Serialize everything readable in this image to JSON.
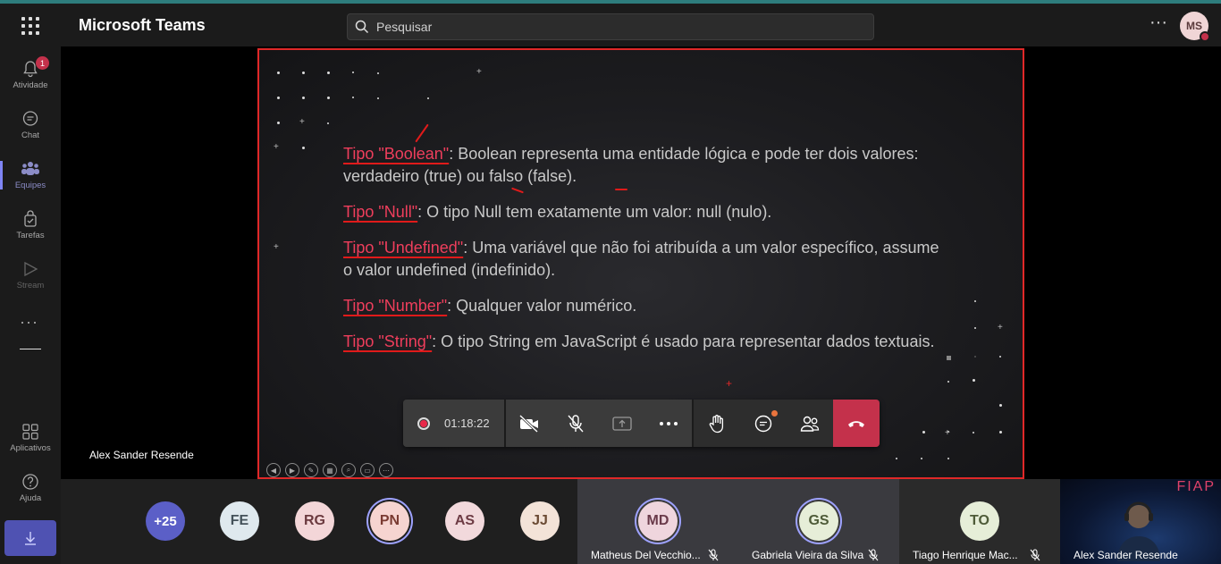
{
  "app": {
    "title": "Microsoft Teams",
    "search_placeholder": "Pesquisar",
    "accent_color": "#2e7d7d",
    "user_initials": "MS"
  },
  "rail": {
    "items": [
      {
        "label": "Atividade",
        "icon": "bell-icon",
        "badge": "1"
      },
      {
        "label": "Chat",
        "icon": "chat-icon"
      },
      {
        "label": "Equipes",
        "icon": "teams-icon",
        "active": true
      },
      {
        "label": "Tarefas",
        "icon": "tasks-icon"
      },
      {
        "label": "Stream",
        "icon": "stream-icon"
      }
    ],
    "more": "···",
    "apps_label": "Aplicativos",
    "help_label": "Ajuda"
  },
  "stage": {
    "presenter_name": "Alex Sander Resende"
  },
  "slide": {
    "items": [
      {
        "keyword": "Tipo \"Boolean\"",
        "text": ": Boolean representa uma entidade lógica e pode ter dois valores: verdadeiro (true) ou falso (false)."
      },
      {
        "keyword": "Tipo \"Null\"",
        "text": ": O tipo Null tem exatamente um valor: null (nulo)."
      },
      {
        "keyword": "Tipo \"Undefined\"",
        "text": ": Uma variável que não foi atribuída a um valor específico, assume o valor undefined (indefinido)."
      },
      {
        "keyword": "Tipo \"Number\"",
        "text": ": Qualquer valor numérico."
      },
      {
        "keyword": "Tipo \"String\"",
        "text": ": O tipo String em JavaScript é usado para representar dados textuais."
      }
    ],
    "keyword_color": "#ef3e5c",
    "annotation_color": "#e01a1a"
  },
  "callbar": {
    "timer": "01:18:22",
    "hangup_color": "#c4314b"
  },
  "participants": {
    "overflow": "+25",
    "avatars": [
      {
        "initials": "FE",
        "bg": "#dfe9ee",
        "fg": "#44525a"
      },
      {
        "initials": "RG",
        "bg": "#f3d6d8",
        "fg": "#6b3a3f"
      },
      {
        "initials": "PN",
        "bg": "#f6d4d0",
        "fg": "#7a3b32",
        "ring": true
      },
      {
        "initials": "AS",
        "bg": "#f2d9dc",
        "fg": "#6d3b44"
      },
      {
        "initials": "JJ",
        "bg": "#f3e3d8",
        "fg": "#6a4a33"
      }
    ],
    "tiles": [
      {
        "name": "Matheus Del Vecchio...",
        "initials": "MD",
        "bg": "#efd5dd",
        "fg": "#6a3a4a"
      },
      {
        "name": "Gabriela Vieira da Silva",
        "initials": "GS",
        "bg": "#e6eed8",
        "fg": "#4e5b38"
      },
      {
        "name": "Tiago Henrique Mac...",
        "initials": "TO",
        "bg": "#e6eed8",
        "fg": "#4e5b38"
      },
      {
        "name": "Alex Sander Resende",
        "brand": "FIAP"
      }
    ]
  }
}
